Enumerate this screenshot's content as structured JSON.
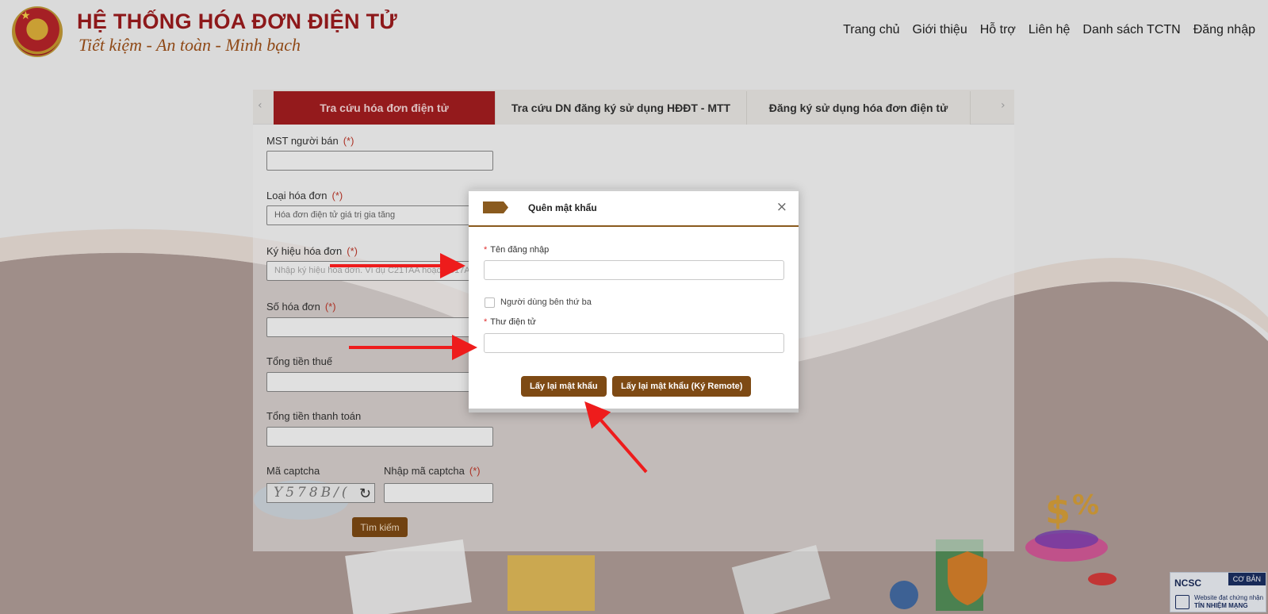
{
  "header": {
    "logo_title": "HỆ THỐNG HÓA ĐƠN ĐIỆN TỬ",
    "logo_slogan": "Tiết kiệm - An toàn - Minh bạch",
    "nav": [
      {
        "label": "Trang chủ"
      },
      {
        "label": "Giới thiệu"
      },
      {
        "label": "Hỗ trợ"
      },
      {
        "label": "Liên hệ"
      },
      {
        "label": "Danh sách TCTN"
      },
      {
        "label": "Đăng nhập"
      }
    ]
  },
  "tabs": [
    {
      "label": "Tra cứu hóa đơn điện tử",
      "active": true
    },
    {
      "label": "Tra cứu DN đăng ký sử dụng HĐĐT - MTT",
      "active": false
    },
    {
      "label": "Đăng ký sử dụng hóa đơn điện tử",
      "active": false
    }
  ],
  "search_form": {
    "required_mark": "(*)",
    "mst_label": "MST người bán",
    "invoice_type_label": "Loại hóa đơn",
    "invoice_type_value": "Hóa đơn điện tử giá trị gia tăng",
    "symbol_label": "Ký hiệu hóa đơn",
    "symbol_placeholder": "Nhập ký hiệu hóa đơn. Ví dụ C21TAA hoặc 1C17AA",
    "number_label": "Số hóa đơn",
    "tax_total_label": "Tổng tiền thuế",
    "payment_total_label": "Tổng tiền thanh toán",
    "captcha_label": "Mã captcha",
    "captcha_input_label": "Nhập mã captcha",
    "captcha_text": "Y578B/(",
    "search_button": "Tìm kiếm"
  },
  "modal": {
    "title": "Quên mật khẩu",
    "required_star": "*",
    "username_label": "Tên đăng nhập",
    "username_value": "",
    "third_party_label": "Người dùng bên thứ ba",
    "third_party_checked": false,
    "email_label": "Thư điện tử",
    "email_value": "",
    "btn_reset": "Lấy lại mật khẩu",
    "btn_reset_remote": "Lấy lại mật khẩu (Ký Remote)"
  },
  "badge": {
    "logo": "NCSC",
    "level": "CƠ BẢN",
    "line1": "Website đạt chứng nhận",
    "line2": "TÍN NHIỆM MẠNG"
  },
  "colors": {
    "brand_red": "#a51d20",
    "brand_brown": "#7e4a14",
    "arrow_red": "#ee1c1c"
  }
}
